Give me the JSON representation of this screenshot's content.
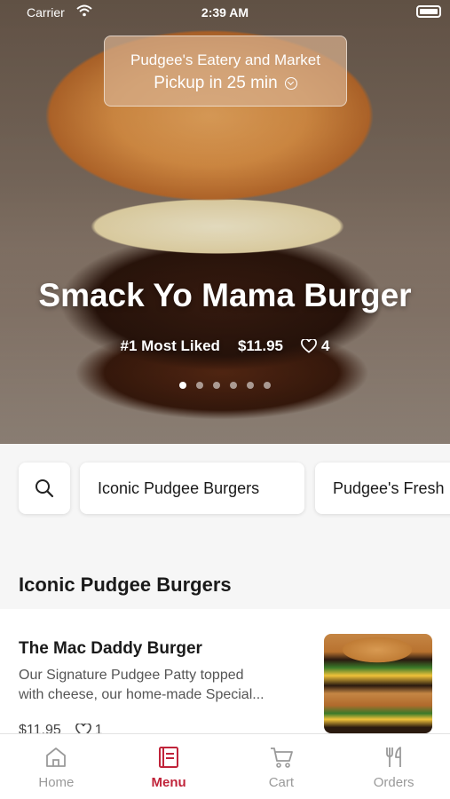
{
  "status_bar": {
    "carrier": "Carrier",
    "time": "2:39 AM"
  },
  "store": {
    "name": "Pudgee's Eatery and Market",
    "pickup": "Pickup in 25 min"
  },
  "hero": {
    "title": "Smack Yo Mama Burger",
    "badge": "#1 Most Liked",
    "price": "$11.95",
    "likes": "4",
    "slide_count": 6,
    "active_slide": 1
  },
  "categories": [
    "Iconic Pudgee Burgers",
    "Pudgee's Fresh"
  ],
  "section": {
    "title": "Iconic Pudgee Burgers"
  },
  "item": {
    "name": "The Mac Daddy Burger",
    "description_line1": "Our Signature Pudgee Patty topped",
    "description_line2": "with cheese, our home-made Special...",
    "price": "$11.95",
    "likes": "1"
  },
  "tabs": [
    {
      "label": "Home",
      "icon": "home-icon"
    },
    {
      "label": "Menu",
      "icon": "menu-icon",
      "active": true
    },
    {
      "label": "Cart",
      "icon": "cart-icon"
    },
    {
      "label": "Orders",
      "icon": "utensils-icon"
    }
  ],
  "colors": {
    "accent": "#c0243a",
    "inactive": "#9a9a9a"
  }
}
